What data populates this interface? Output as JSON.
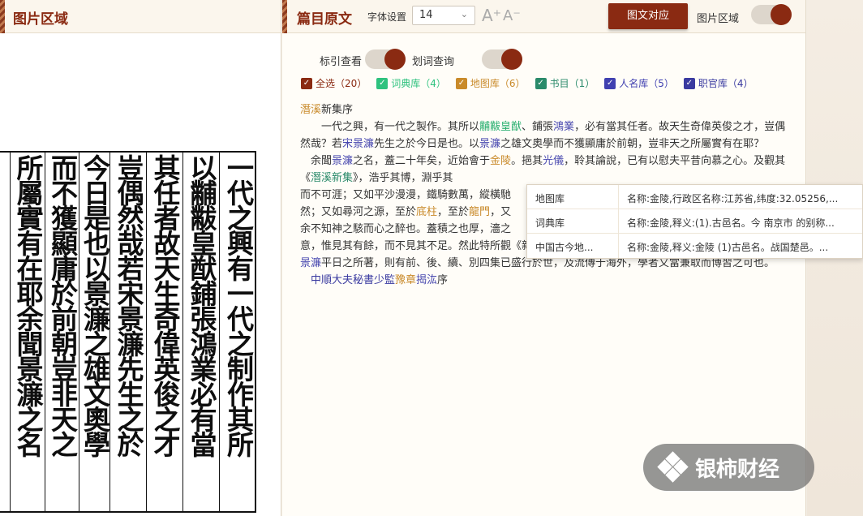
{
  "left": {
    "title": "图片区域"
  },
  "scan_columns": [
    "一代之興有一代之制作其所",
    "以黼黻皇猷鋪張鴻業必有當",
    "其任者故天生奇偉英俊之才",
    "豈偶然哉若宋景濂先生之於",
    "今日是也以景濂之雄文奧學",
    "而不獲顯庸於前朝豈非天之",
    "所屬實有在耶余聞景濂之名"
  ],
  "header": {
    "title": "篇目原文",
    "font_label": "字体设置",
    "font_size": "14",
    "font_inc": "A⁺",
    "font_dec": "A⁻",
    "align_button": "图文对应",
    "image_area_label": "图片区域"
  },
  "options": {
    "biaoyin": "标引查看",
    "huaci": "划词查询"
  },
  "filters": [
    {
      "label": "全选（20）",
      "color": "#8a2a12"
    },
    {
      "label": "词典库（4）",
      "color": "#2ec27e"
    },
    {
      "label": "地图库（6）",
      "color": "#c98a2a"
    },
    {
      "label": "书目（1）",
      "color": "#2a8a6a"
    },
    {
      "label": "人名库（5）",
      "color": "#4040b0"
    },
    {
      "label": "职官库（4）",
      "color": "#3a3aa0"
    }
  ],
  "text": {
    "title_a": "潛溪",
    "title_b": "新集序",
    "p1_a": "　　一代之興，有一代之製作。其所以",
    "p1_w1": "黼黻皇猷",
    "p1_b": "、鋪張",
    "p1_w2": "鴻業",
    "p1_c": "，必有當其任者。故天生奇偉英俊之才，豈偶然哉？若",
    "p1_n1": "宋景濂",
    "p1_d": "先生之於今日是也。以",
    "p1_n2": "景濂",
    "p1_e": "之雄文奧學而不獲顯庸於前朝，豈非天之所屬實有在耶？",
    "p2_a": "　余聞",
    "p2_n1": "景濂",
    "p2_b": "之名，蓋二十年矣，近始會于",
    "p2_p1": "金陵",
    "p2_c": "。挹其",
    "p2_n2": "光儀",
    "p2_d": "，聆其論說，已有以慰夫平昔向慕之心。及觀其《",
    "p2_bk": "潛溪新集",
    "p2_e": "》，浩乎其博，淵乎其",
    "line4": "而不可涯；又如平沙漫漫，鐵騎數萬，縱橫馳",
    "line5_a": "然；又如尋河之源，至於",
    "line5_p1": "底柱",
    "line5_b": "，至於",
    "line5_p2": "龍門",
    "line5_c": "，又",
    "line6": "余不知神之駭而心之醉也。蓋積之也厚，濇之",
    "line7": "意，惟見其有餘，而不見其不足。然此特所觀《新集》者而已，皆應制代言、紀功銘德之作。若",
    "line8_n": "景濂",
    "line8": "平日之所著，則有前、後、續、別四集已盛行於世，及流傳于海外，學者又當兼取而博習之可也。",
    "sign_a": "　中順大夫秘書少監",
    "sign_p": "豫章",
    "sign_n": "揭汯",
    "sign_b": "序"
  },
  "tooltip": [
    {
      "k": "地图库",
      "v": "名称:金陵,行政区名称:江苏省,纬度:32.05256,..."
    },
    {
      "k": "词典库",
      "v": "名称:金陵,释义:(1).古邑名。今 南京市 的别称..."
    },
    {
      "k": "中国古今地...",
      "v": "名称:金陵,释义:金陵 (1)古邑名。战国楚邑。..."
    }
  ],
  "watermark": "银柿财经"
}
